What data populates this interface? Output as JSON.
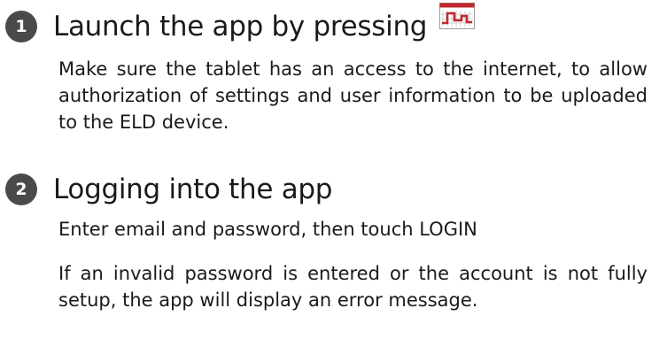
{
  "steps": [
    {
      "number": "1",
      "title": "Launch the app by pressing",
      "icon": "eld-app-icon",
      "paragraphs": [
        "Make sure the tablet has an access to the internet, to allow authorization of settings and user information to be uploaded to the ELD device."
      ]
    },
    {
      "number": "2",
      "title": "Logging into the app",
      "paragraphs": [
        "Enter email and password, then touch LOGIN",
        "If an invalid password is entered or the account is not fully setup, the app will display an error message."
      ]
    }
  ],
  "colors": {
    "badge": "#4a4a4a",
    "icon_red": "#c0272d",
    "text": "#1a1a1a"
  }
}
